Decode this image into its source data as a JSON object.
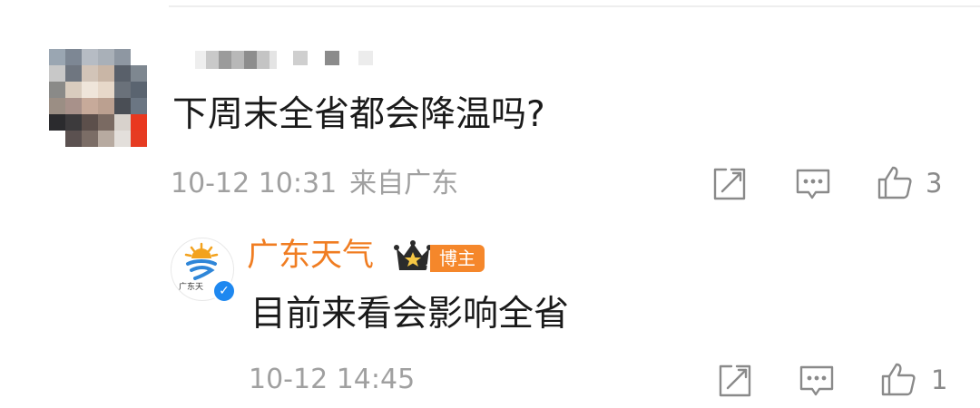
{
  "comment": {
    "text": "下周末全省都会降温吗?",
    "date": "10-12 10:31",
    "location": "来自广东",
    "like_count": "3"
  },
  "reply": {
    "author": "广东天气",
    "avatar_label": "广东天",
    "badge": "博主",
    "crown_level": "1",
    "text": "目前来看会影响全省",
    "date": "10-12 14:45",
    "like_count": "1"
  },
  "icons": {
    "repost": "share-icon",
    "comment": "comment-icon",
    "like": "thumbs-up-icon",
    "verified": "verified-check-icon",
    "crown": "crown-icon"
  },
  "colors": {
    "author_name": "#f07d22",
    "badge_bg": "#f5872b",
    "verified": "#1e88f0",
    "meta_text": "#a0a0a0"
  }
}
